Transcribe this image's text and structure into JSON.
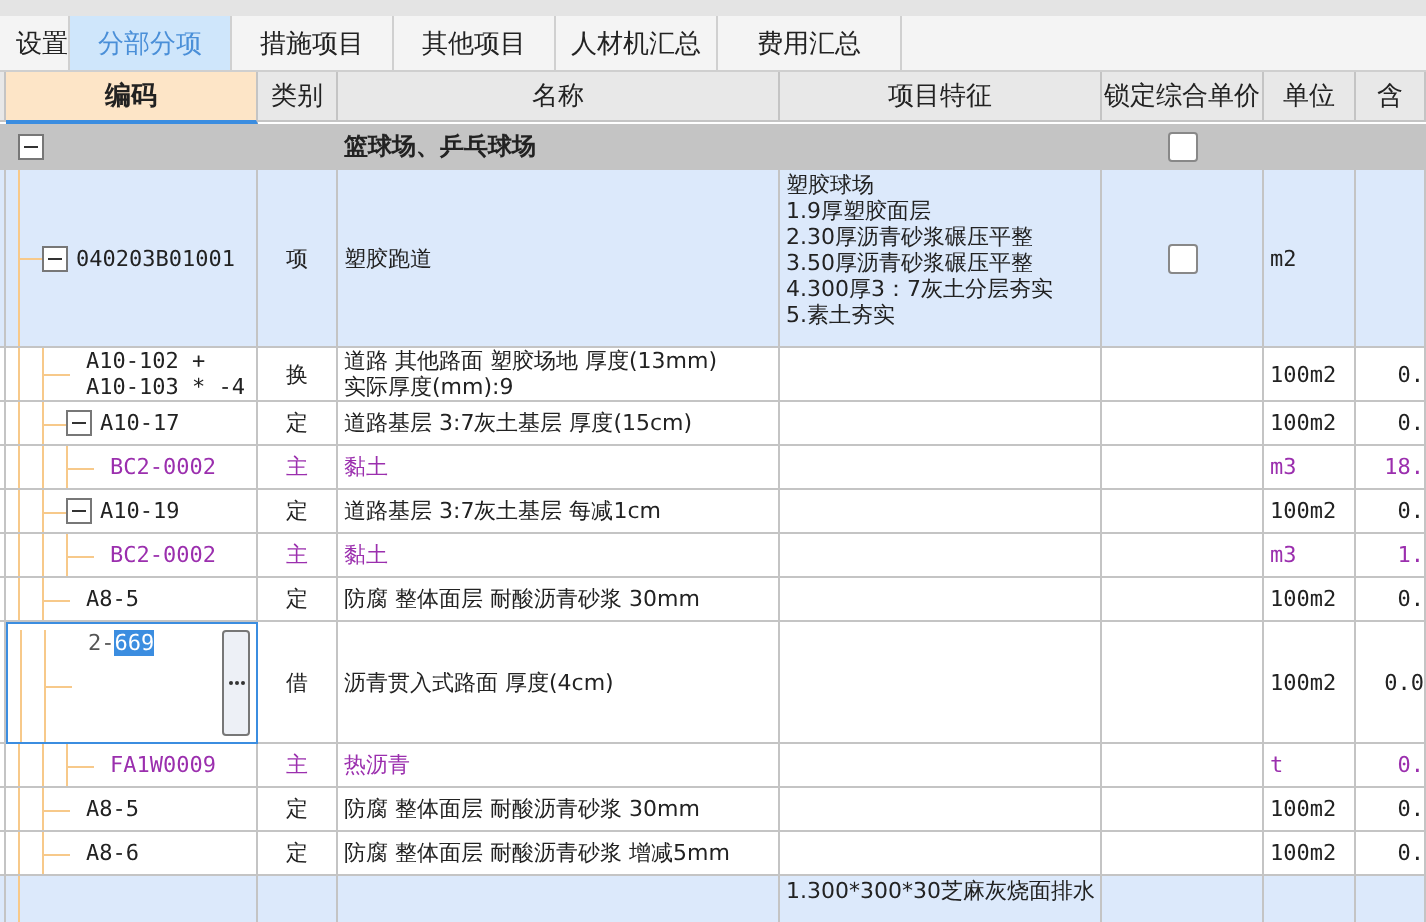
{
  "tabs": [
    {
      "label": "设置",
      "selected": false
    },
    {
      "label": "分部分项",
      "selected": true
    },
    {
      "label": "措施项目",
      "selected": false
    },
    {
      "label": "其他项目",
      "selected": false
    },
    {
      "label": "人材机汇总",
      "selected": false
    },
    {
      "label": "费用汇总",
      "selected": false
    }
  ],
  "columns": [
    {
      "label": "编码",
      "selected": true
    },
    {
      "label": "类别",
      "selected": false
    },
    {
      "label": "名称",
      "selected": false
    },
    {
      "label": "项目特征",
      "selected": false
    },
    {
      "label": "锁定综合单价",
      "selected": false
    },
    {
      "label": "单位",
      "selected": false
    },
    {
      "label": "含",
      "selected": false
    }
  ],
  "rows": [
    {
      "kind": "section",
      "name": "篮球场、乒乓球场",
      "expanded": true,
      "locked": false,
      "children": [
        {
          "kind": "item",
          "code": "040203B01001",
          "type": "项",
          "name": "塑胶跑道",
          "feature": "塑胶球场\n1.9厚塑胶面层\n2.30厚沥青砂浆碾压平整\n3.50厚沥青砂浆碾压平整\n4.300厚3：7灰土分层夯实\n5.素土夯实",
          "locked": false,
          "unit": "m2",
          "expanded": true,
          "children": [
            {
              "kind": "norm",
              "code": "A10-102 +\nA10-103 * -4",
              "type": "换",
              "name": "道路 其他路面 塑胶场地 厚度(13mm)\n实际厚度(mm):9",
              "unit": "100m2",
              "qty": "0."
            },
            {
              "kind": "norm",
              "code": "A10-17",
              "type": "定",
              "name": "道路基层 3:7灰土基层 厚度(15cm)",
              "unit": "100m2",
              "qty": "0.",
              "expanded": true,
              "children": [
                {
                  "kind": "material",
                  "code": "BC2-0002",
                  "type": "主",
                  "name": "黏土",
                  "unit": "m3",
                  "qty": "18."
                }
              ]
            },
            {
              "kind": "norm",
              "code": "A10-19",
              "type": "定",
              "name": "道路基层 3:7灰土基层 每减1cm",
              "unit": "100m2",
              "qty": "0.",
              "expanded": true,
              "children": [
                {
                  "kind": "material",
                  "code": "BC2-0002",
                  "type": "主",
                  "name": "黏土",
                  "unit": "m3",
                  "qty": "1."
                }
              ]
            },
            {
              "kind": "norm",
              "code": "A8-5",
              "type": "定",
              "name": "防腐 整体面层 耐酸沥青砂浆 30mm",
              "unit": "100m2",
              "qty": "0."
            },
            {
              "kind": "norm",
              "code": "2-669",
              "editing": true,
              "type": "借",
              "name": "沥青贯入式路面 厚度(4cm)",
              "unit": "100m2",
              "qty": "0.0",
              "children": [
                {
                  "kind": "material",
                  "code": "FA1W0009",
                  "type": "主",
                  "name": "热沥青",
                  "unit": "t",
                  "qty": "0."
                }
              ]
            },
            {
              "kind": "norm",
              "code": "A8-5",
              "type": "定",
              "name": "防腐 整体面层 耐酸沥青砂浆 30mm",
              "unit": "100m2",
              "qty": "0."
            },
            {
              "kind": "norm",
              "code": "A8-6",
              "type": "定",
              "name": "防腐 整体面层 耐酸沥青砂浆 增减5mm",
              "unit": "100m2",
              "qty": "0."
            }
          ]
        },
        {
          "kind": "item",
          "feature": "1.300*300*30芝麻灰烧面排水"
        }
      ]
    }
  ]
}
